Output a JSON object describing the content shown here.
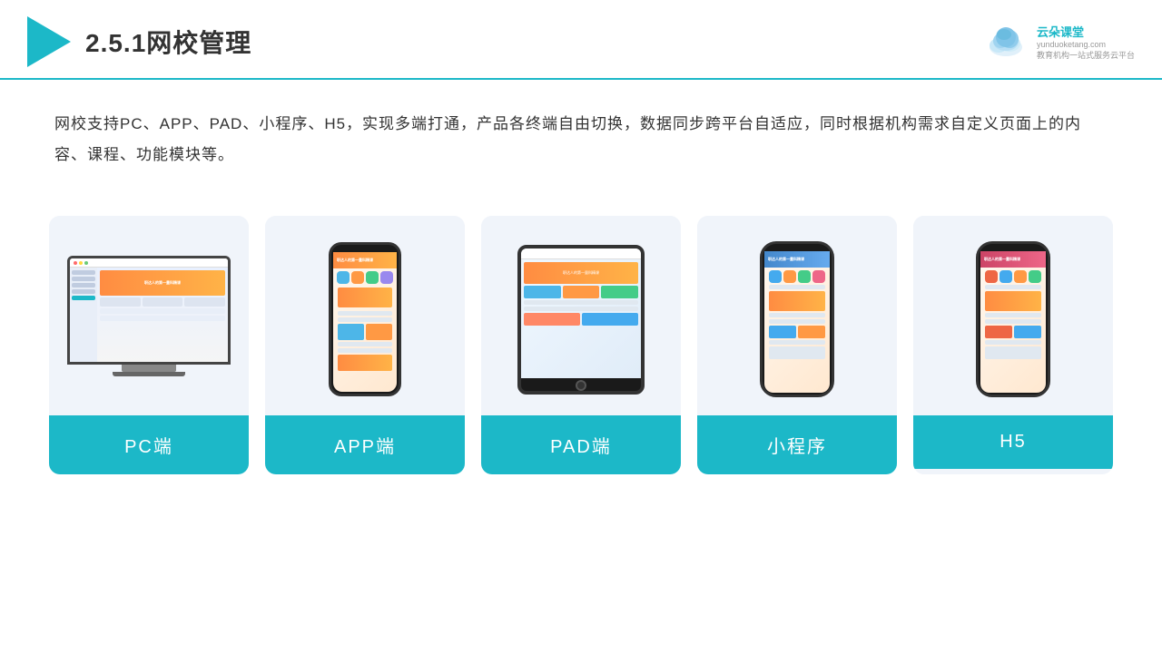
{
  "header": {
    "title": "2.5.1网校管理",
    "brand": {
      "name_cn": "云朵课堂",
      "domain": "yunduoketang.com",
      "tagline": "教育机构一站",
      "tagline2": "式服务云平台"
    }
  },
  "description": {
    "text": "网校支持PC、APP、PAD、小程序、H5，实现多端打通，产品各终端自由切换，数据同步跨平台自适应，同时根据机构需求自定义页面上的内容、课程、功能模块等。"
  },
  "cards": [
    {
      "id": "pc",
      "label": "PC端"
    },
    {
      "id": "app",
      "label": "APP端"
    },
    {
      "id": "pad",
      "label": "PAD端"
    },
    {
      "id": "mini",
      "label": "小程序"
    },
    {
      "id": "h5",
      "label": "H5"
    }
  ],
  "colors": {
    "accent": "#1cb8c8",
    "text_dark": "#333333",
    "bg_card": "#f0f4fa"
  }
}
